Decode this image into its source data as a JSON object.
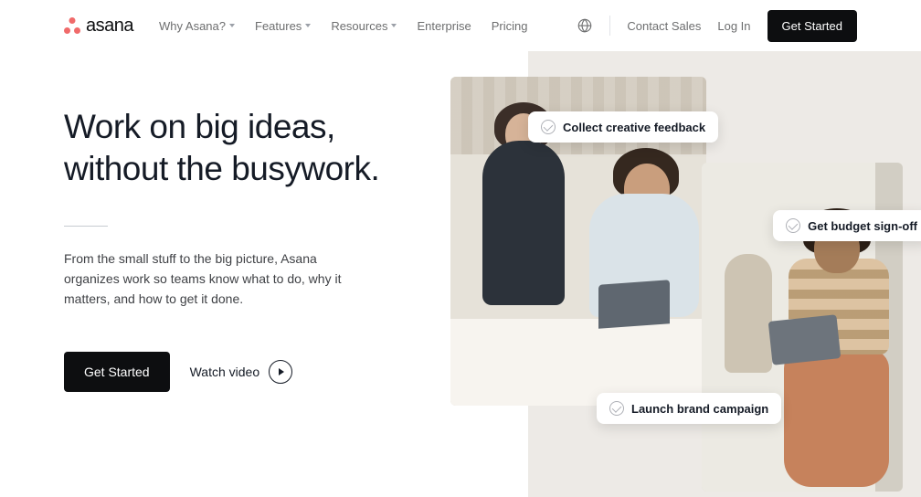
{
  "brand": "asana",
  "nav": {
    "items": [
      {
        "label": "Why Asana?",
        "dropdown": true
      },
      {
        "label": "Features",
        "dropdown": true
      },
      {
        "label": "Resources",
        "dropdown": true
      },
      {
        "label": "Enterprise",
        "dropdown": false
      },
      {
        "label": "Pricing",
        "dropdown": false
      }
    ],
    "contact": "Contact Sales",
    "login": "Log In",
    "get_started": "Get Started"
  },
  "hero": {
    "title_line1": "Work on big ideas,",
    "title_line2": "without the busywork.",
    "subtitle": "From the small stuff to the big picture, Asana organizes work so teams know what to do, why it matters, and how to get it done.",
    "cta": "Get Started",
    "watch": "Watch video"
  },
  "chips": [
    "Collect creative feedback",
    "Get budget sign-off",
    "Launch brand campaign"
  ]
}
